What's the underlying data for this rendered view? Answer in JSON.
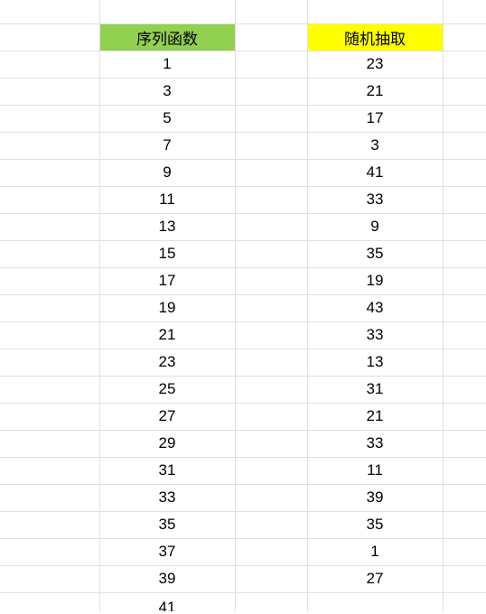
{
  "headers": {
    "sequence": "序列函数",
    "random": "随机抽取"
  },
  "rows": [
    {
      "seq": "1",
      "rand": "23"
    },
    {
      "seq": "3",
      "rand": "21"
    },
    {
      "seq": "5",
      "rand": "17"
    },
    {
      "seq": "7",
      "rand": "3"
    },
    {
      "seq": "9",
      "rand": "41"
    },
    {
      "seq": "11",
      "rand": "33"
    },
    {
      "seq": "13",
      "rand": "9"
    },
    {
      "seq": "15",
      "rand": "35"
    },
    {
      "seq": "17",
      "rand": "19"
    },
    {
      "seq": "19",
      "rand": "43"
    },
    {
      "seq": "21",
      "rand": "33"
    },
    {
      "seq": "23",
      "rand": "13"
    },
    {
      "seq": "25",
      "rand": "31"
    },
    {
      "seq": "27",
      "rand": "21"
    },
    {
      "seq": "29",
      "rand": "33"
    },
    {
      "seq": "31",
      "rand": "11"
    },
    {
      "seq": "33",
      "rand": "39"
    },
    {
      "seq": "35",
      "rand": "35"
    },
    {
      "seq": "37",
      "rand": "1"
    },
    {
      "seq": "39",
      "rand": "27"
    }
  ],
  "partial": {
    "seq": "41"
  }
}
